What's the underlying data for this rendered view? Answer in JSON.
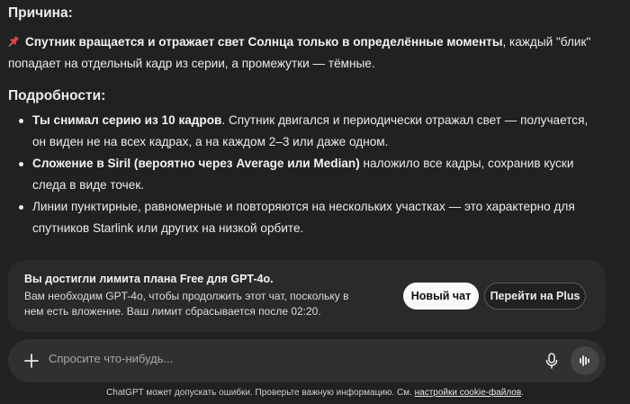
{
  "answer": {
    "cause_heading": "Причина:",
    "cause_pin_icon": "pushpin-icon",
    "cause_bold": "Спутник вращается и отражает свет Солнца только в определённые моменты",
    "cause_rest": ", каждый \"блик\" попадает на отдельный кадр из серии, а промежутки — тёмные.",
    "details_heading": "Подробности:",
    "details": [
      {
        "bold": "Ты снимал серию из 10 кадров",
        "rest": ". Спутник двигался и периодически отражал свет — получается, он виден не на всех кадрах, а на каждом 2–3 или даже одном."
      },
      {
        "bold": "Сложение в Siril (вероятно через Average или Median)",
        "rest": " наложило все кадры, сохранив куски следа в виде точек."
      },
      {
        "bold": "",
        "rest": "Линии пунктирные, равномерные и повторяются на нескольких участках — это характерно для спутников Starlink или других на низкой орбите."
      }
    ]
  },
  "limit_banner": {
    "title": "Вы достигли лимита плана Free для GPT-4o.",
    "text": "Вам необходим GPT-4o, чтобы продолжить этот чат, поскольку в нем есть вложение. Ваш лимит сбрасывается после 02:20.",
    "new_chat_label": "Новый чат",
    "upgrade_label": "Перейти на Plus"
  },
  "composer": {
    "placeholder": "Спросите что-нибудь...",
    "plus_icon": "plus-icon",
    "mic_icon": "microphone-icon",
    "voice_icon": "voice-mode-icon"
  },
  "footer": {
    "text": "ChatGPT может допускать ошибки. Проверьте важную информацию. См. ",
    "link": "настройки cookie-файлов",
    "suffix": "."
  }
}
